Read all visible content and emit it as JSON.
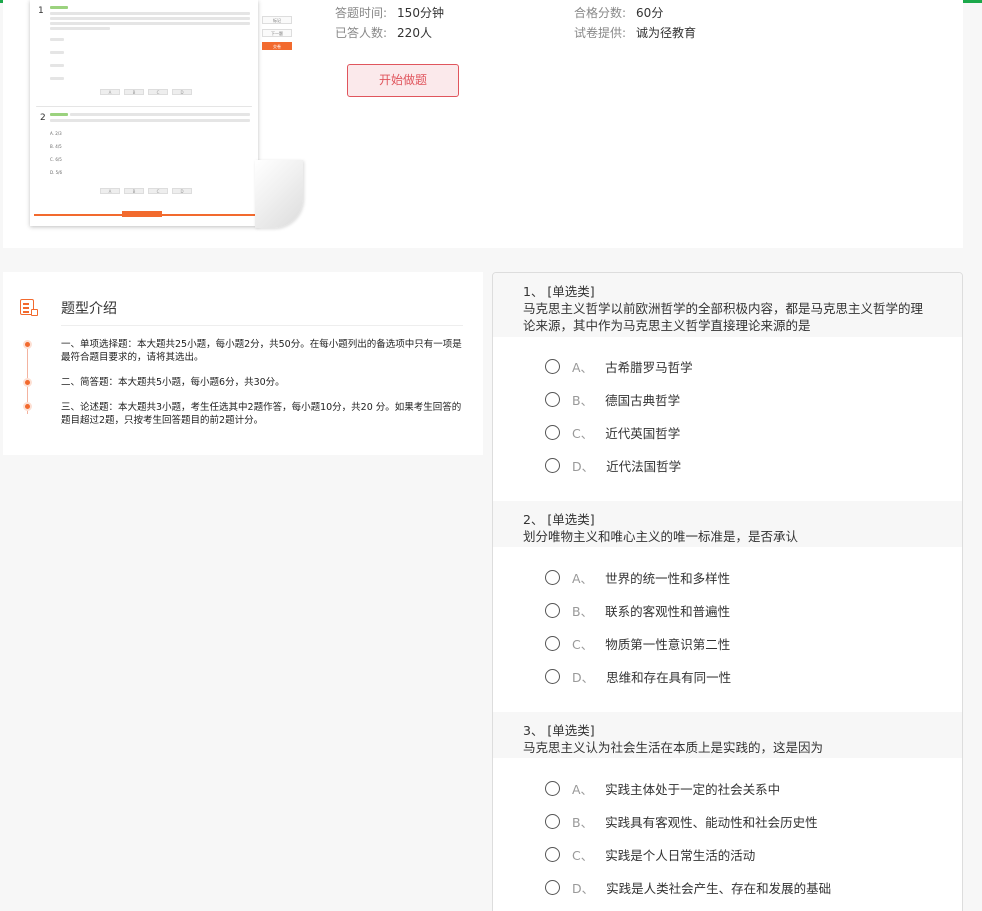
{
  "exam_info": {
    "duration_label": "答题时间:",
    "duration_value": "150分钟",
    "pass_label": "合格分数:",
    "pass_value": "60分",
    "answered_label": "已答人数:",
    "answered_value": "220人",
    "provider_label": "试卷提供:",
    "provider_value": "诚为径教育",
    "start_button": "开始做题"
  },
  "preview": {
    "q1_num": "1",
    "q2_num": "2",
    "options": [
      "A. 2/3",
      "B. 4/5",
      "C. 6/5",
      "D. 5/6"
    ],
    "buttons": [
      "A",
      "B",
      "C",
      "D"
    ],
    "side_buttons": [
      "标记",
      "下一题",
      "交卷"
    ]
  },
  "intro": {
    "title": "题型介绍",
    "items": [
      "一、单项选择题：本大题共25小题，每小题2分，共50分。在每小题列出的备选项中只有一项是最符合题目要求的，请将其选出。",
      "二、简答题：本大题共5小题，每小题6分，共30分。",
      "三、论述题：本大题共3小题，考生任选其中2题作答，每小题10分，共20 分。如果考生回答的题目超过2题，只按考生回答题目的前2题计分。"
    ]
  },
  "questions": [
    {
      "header": "1、 [单选类]",
      "text": "马克思主义哲学以前欧洲哲学的全部积极内容，都是马克思主义哲学的理论来源，其中作为马克思主义哲学直接理论来源的是",
      "options": [
        {
          "letter": "A、",
          "text": "古希腊罗马哲学"
        },
        {
          "letter": "B、",
          "text": "德国古典哲学"
        },
        {
          "letter": "C、",
          "text": "近代英国哲学"
        },
        {
          "letter": "D、",
          "text": "近代法国哲学"
        }
      ]
    },
    {
      "header": "2、 [单选类]",
      "text": "划分唯物主义和唯心主义的唯一标准是，是否承认",
      "options": [
        {
          "letter": "A、",
          "text": "世界的统一性和多样性"
        },
        {
          "letter": "B、",
          "text": "联系的客观性和普遍性"
        },
        {
          "letter": "C、",
          "text": "物质第一性意识第二性"
        },
        {
          "letter": "D、",
          "text": "思维和存在具有同一性"
        }
      ]
    },
    {
      "header": "3、 [单选类]",
      "text": "马克思主义认为社会生活在本质上是实践的，这是因为",
      "options": [
        {
          "letter": "A、",
          "text": "实践主体处于一定的社会关系中"
        },
        {
          "letter": "B、",
          "text": "实践具有客观性、能动性和社会历史性"
        },
        {
          "letter": "C、",
          "text": "实践是个人日常生活的活动"
        },
        {
          "letter": "D、",
          "text": "实践是人类社会产生、存在和发展的基础"
        }
      ]
    }
  ]
}
